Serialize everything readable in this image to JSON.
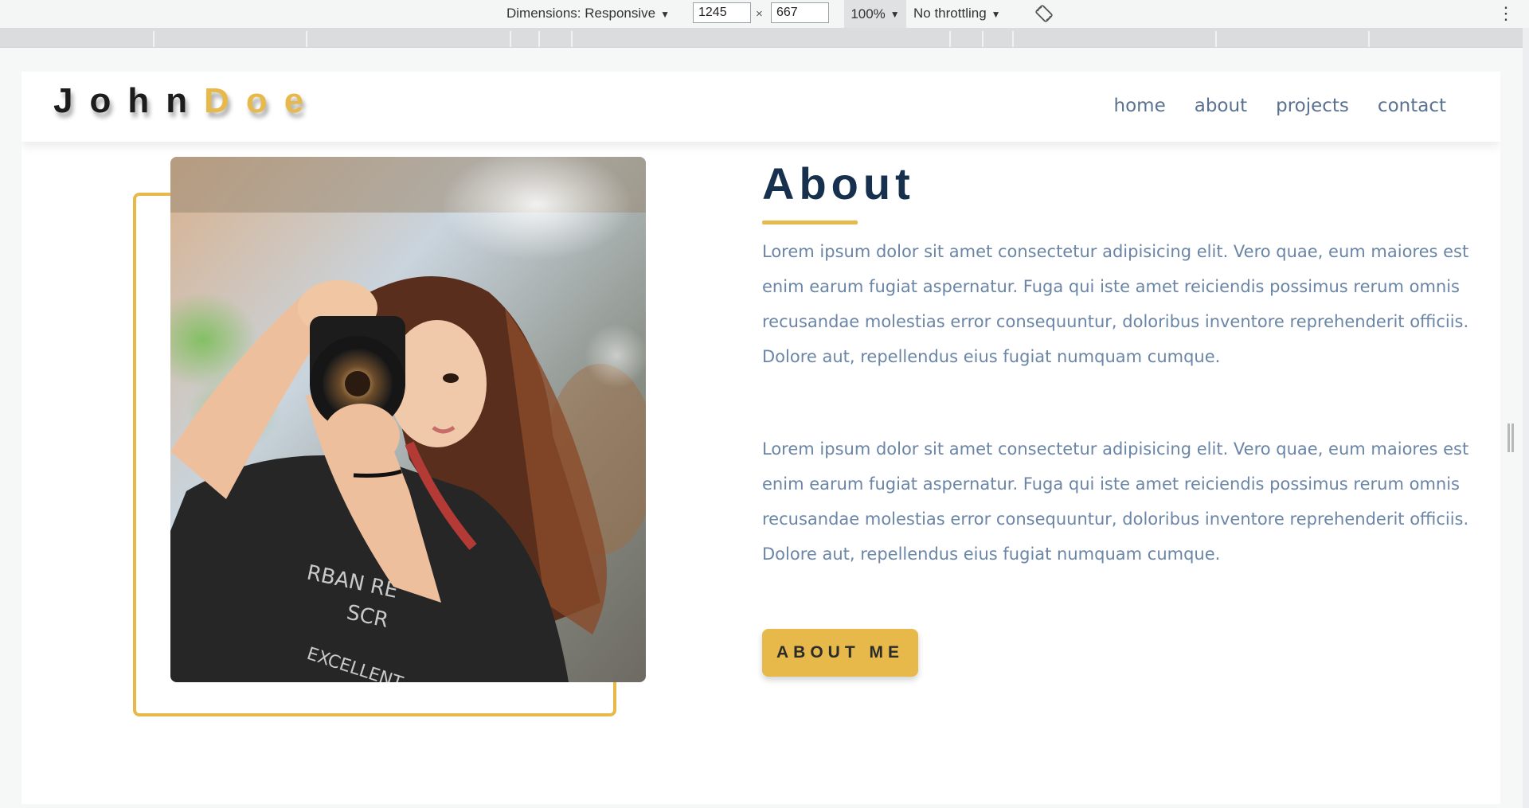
{
  "devtools": {
    "dimensions_label": "Dimensions: Responsive",
    "width_value": "1245",
    "times_sign": "×",
    "height_value": "667",
    "zoom_label": "100%",
    "throttling_label": "No throttling",
    "rotate_icon": "rotate-icon",
    "more_icon": "more-vertical-icon"
  },
  "site": {
    "logo_first": "John",
    "logo_last": "Doe",
    "nav": [
      "home",
      "about",
      "projects",
      "contact"
    ]
  },
  "about": {
    "title": "About",
    "paragraphs": [
      "Lorem ipsum dolor sit amet consectetur adipisicing elit. Vero quae, eum maiores est enim earum fugiat aspernatur. Fuga qui iste amet reiciendis possimus rerum omnis recusandae molestias error consequuntur, doloribus inventore reprehenderit officiis. Dolore aut, repellendus eius fugiat numquam cumque.",
      "Lorem ipsum dolor sit amet consectetur adipisicing elit. Vero quae, eum maiores est enim earum fugiat aspernatur. Fuga qui iste amet reiciendis possimus rerum omnis recusandae molestias error consequuntur, doloribus inventore reprehenderit officiis. Dolore aut, repellendus eius fugiat numquam cumque."
    ],
    "button_label": "ABOUT ME"
  },
  "colors": {
    "accent": "#e7b94a",
    "title": "#17304d",
    "body_text": "#6a85a6",
    "nav_text": "#5a7290"
  }
}
